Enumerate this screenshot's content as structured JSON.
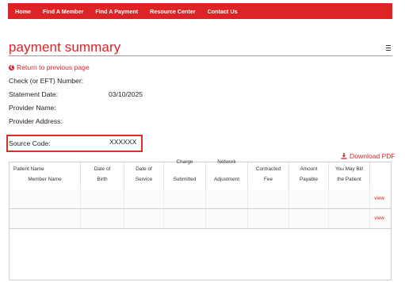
{
  "nav": {
    "items": [
      {
        "label": "Home"
      },
      {
        "label": "Find A Member"
      },
      {
        "label": "Find A Payment"
      },
      {
        "label": "Resource Center"
      },
      {
        "label": "Contact Us"
      }
    ]
  },
  "page": {
    "title": "payment summary",
    "back_link": "Return to previous page",
    "menu_icon": "hamburger-menu-icon"
  },
  "fields": {
    "check_label": "Check (or EFT) Number:",
    "check_value": "",
    "statement_date_label": "Statement Date:",
    "statement_date_value": "03/10/2025",
    "provider_name_label": "Provider Name:",
    "provider_name_value": "",
    "provider_address_label": "Provider Address:",
    "provider_address_value": "",
    "source_code_label": "Source Code:",
    "source_code_value": "XXXXXX"
  },
  "download": {
    "label": "Download PDF",
    "icon": "download-icon"
  },
  "table": {
    "headers": [
      {
        "l1": "Patient Name",
        "l2": "Member Name"
      },
      {
        "l1": "Date of",
        "l2": "Birth"
      },
      {
        "l1": "Date of",
        "l2": "Service"
      },
      {
        "l1": "Charge",
        "l2": "Submitted"
      },
      {
        "l1": "Network",
        "l2": "Adjustment"
      },
      {
        "l1": "Contracted",
        "l2": "Fee"
      },
      {
        "l1": "Amount",
        "l2": "Payable"
      },
      {
        "l1": "You May Bill",
        "l2": "the Patient"
      },
      {
        "l1": "",
        "l2": ""
      }
    ],
    "rows": [
      {
        "action": "view"
      },
      {
        "action": "view"
      }
    ]
  },
  "colors": {
    "brand_red": "#dd2326",
    "highlight_border": "#d9301f"
  }
}
